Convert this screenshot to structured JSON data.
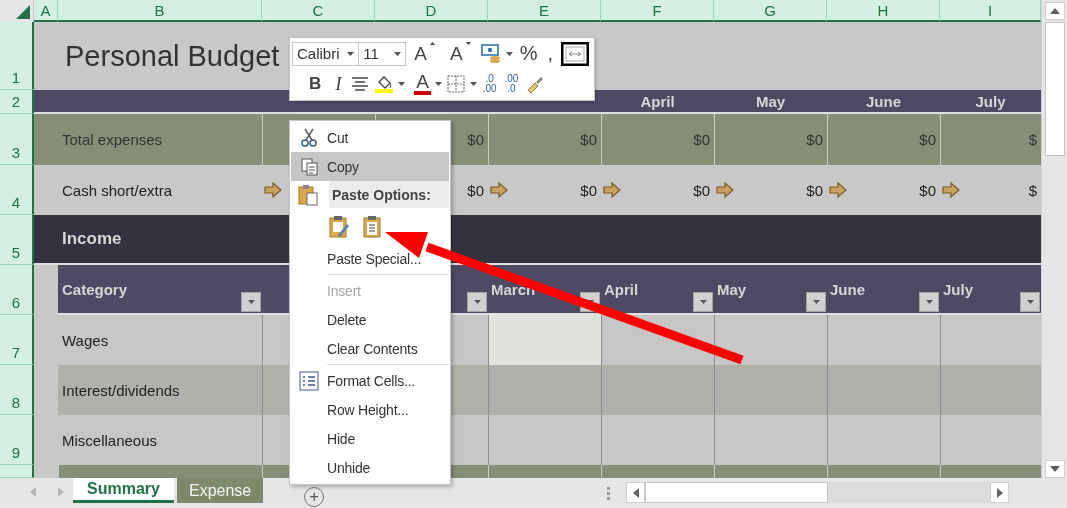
{
  "columns": [
    "A",
    "B",
    "C",
    "D",
    "E",
    "F",
    "G",
    "H",
    "I"
  ],
  "rows": [
    {
      "number": "1",
      "kind": "title",
      "title": "Personal Budget"
    },
    {
      "number": "2",
      "kind": "months",
      "months": [
        "April",
        "May",
        "June",
        "July"
      ]
    },
    {
      "number": "3",
      "kind": "total",
      "label": "Total expenses",
      "values": [
        "$0",
        "$0",
        "$0",
        "$0",
        "$0",
        "$"
      ]
    },
    {
      "number": "4",
      "kind": "cash",
      "label": "Cash short/extra",
      "cells": [
        {
          "arrow": true
        },
        {
          "value": "$0"
        },
        {
          "arrow": true,
          "value": "$0"
        },
        {
          "arrow": true,
          "value": "$0"
        },
        {
          "arrow": true,
          "value": "$0"
        },
        {
          "arrow": true,
          "value": "$0"
        },
        {
          "arrow": true,
          "value": "$"
        }
      ]
    },
    {
      "number": "5",
      "kind": "section",
      "title": "Income"
    },
    {
      "number": "6",
      "kind": "table-header",
      "headers": [
        {
          "kind": "labeled",
          "label": "Category"
        },
        {
          "kind": "blank"
        },
        {
          "kind": "filter-only"
        },
        {
          "kind": "labeled",
          "label": "March"
        },
        {
          "kind": "labeled",
          "label": "April"
        },
        {
          "kind": "labeled",
          "label": "May"
        },
        {
          "kind": "labeled",
          "label": "June"
        },
        {
          "kind": "labeled",
          "label": "July"
        }
      ]
    },
    {
      "number": "7",
      "kind": "income",
      "label": "Wages",
      "cells": [
        {
          "selected": false
        },
        {
          "selected": false
        },
        {
          "selected": true
        },
        {
          "selected": false
        },
        {
          "selected": false
        },
        {
          "selected": false
        },
        {
          "selected": false
        }
      ]
    },
    {
      "number": "8",
      "kind": "income",
      "label": "Interest/dividends",
      "cells": [
        {
          "selected": false
        },
        {
          "selected": false
        },
        {
          "selected": false
        },
        {
          "selected": false
        },
        {
          "selected": false
        },
        {
          "selected": false
        },
        {
          "selected": false
        }
      ]
    },
    {
      "number": "9",
      "kind": "income",
      "label": "Miscellaneous",
      "cells": [
        {
          "selected": false
        },
        {
          "selected": false
        },
        {
          "selected": false
        },
        {
          "selected": false
        },
        {
          "selected": false
        },
        {
          "selected": false
        },
        {
          "selected": false
        }
      ]
    }
  ],
  "mini_toolbar": {
    "font": "Calibri",
    "size": "11",
    "top_buttons": [
      {
        "kind": "grow",
        "text": "A"
      },
      {
        "kind": "shrink",
        "text": "A"
      },
      {
        "kind": "accounting",
        "dropdown": true
      },
      {
        "kind": "glyph",
        "text": "%"
      },
      {
        "kind": "glyph",
        "text": ","
      },
      {
        "kind": "merge"
      }
    ],
    "bottom_buttons": [
      {
        "kind": "bold",
        "text": "B"
      },
      {
        "kind": "italic",
        "text": "I"
      },
      {
        "kind": "center"
      },
      {
        "kind": "fill",
        "dropdown": true
      },
      {
        "kind": "font-color",
        "text": "A",
        "dropdown": true
      },
      {
        "kind": "borders",
        "dropdown": true
      },
      {
        "kind": "increase-decimal",
        "lines": [
          ".0",
          ".00"
        ]
      },
      {
        "kind": "decrease-decimal",
        "lines": [
          ".00",
          ".0"
        ]
      },
      {
        "kind": "painter"
      }
    ]
  },
  "context_menu": {
    "items": [
      {
        "kind": "cut",
        "label": "Cut",
        "selected": false,
        "disabled": false
      },
      {
        "kind": "copy",
        "label": "Copy",
        "selected": true,
        "disabled": false
      },
      {
        "kind": "paste-header",
        "label": "Paste Options:"
      },
      {
        "kind": "paste-options"
      },
      {
        "kind": "command",
        "label": "Paste Special...",
        "selected": false,
        "disabled": false
      },
      {
        "kind": "separator"
      },
      {
        "kind": "command",
        "label": "Insert",
        "selected": false,
        "disabled": true
      },
      {
        "kind": "command",
        "label": "Delete",
        "selected": false,
        "disabled": false
      },
      {
        "kind": "command",
        "label": "Clear Contents",
        "selected": false,
        "disabled": false
      },
      {
        "kind": "separator"
      },
      {
        "kind": "format",
        "label": "Format Cells...",
        "selected": false,
        "disabled": false
      },
      {
        "kind": "command",
        "label": "Row Height...",
        "selected": false,
        "disabled": false
      },
      {
        "kind": "command",
        "label": "Hide",
        "selected": false,
        "disabled": false
      },
      {
        "kind": "command",
        "label": "Unhide",
        "selected": false,
        "disabled": false
      }
    ]
  },
  "pointer_arrow": true,
  "sheet_tabs": [
    {
      "label": "Summary",
      "selected": true
    },
    {
      "label": "Expense",
      "selected": false
    }
  ],
  "new_sheet": "+"
}
